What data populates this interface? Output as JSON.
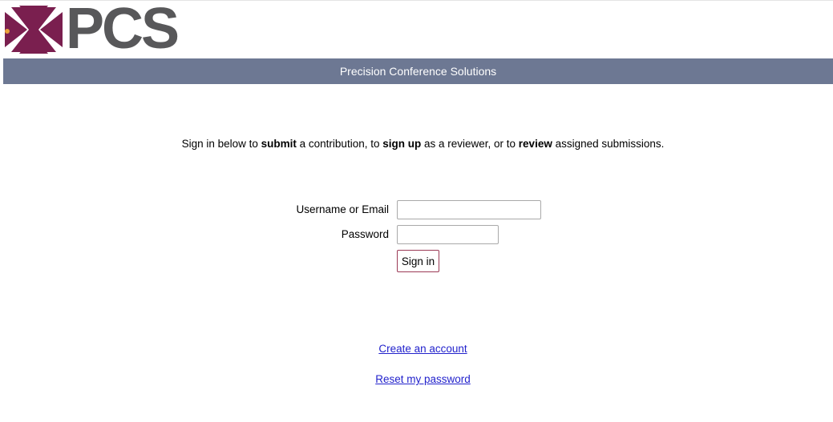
{
  "logo": {
    "text": "PCS",
    "mark_icon": "pcs-star-logo-icon",
    "brand_color": "#7a1f4f",
    "text_color": "#58585a"
  },
  "banner": {
    "title": "Precision Conference Solutions",
    "background": "#6d7893"
  },
  "intro": {
    "part1": "Sign in below to ",
    "bold1": "submit",
    "part2": " a contribution, to ",
    "bold2": "sign up",
    "part3": " as a reviewer, or to ",
    "bold3": "review",
    "part4": " assigned submissions."
  },
  "form": {
    "username_label": "Username or Email",
    "username_value": "",
    "password_label": "Password",
    "password_value": "",
    "signin_label": "Sign in"
  },
  "links": {
    "create_account": "Create an account",
    "reset_password": "Reset my password"
  }
}
